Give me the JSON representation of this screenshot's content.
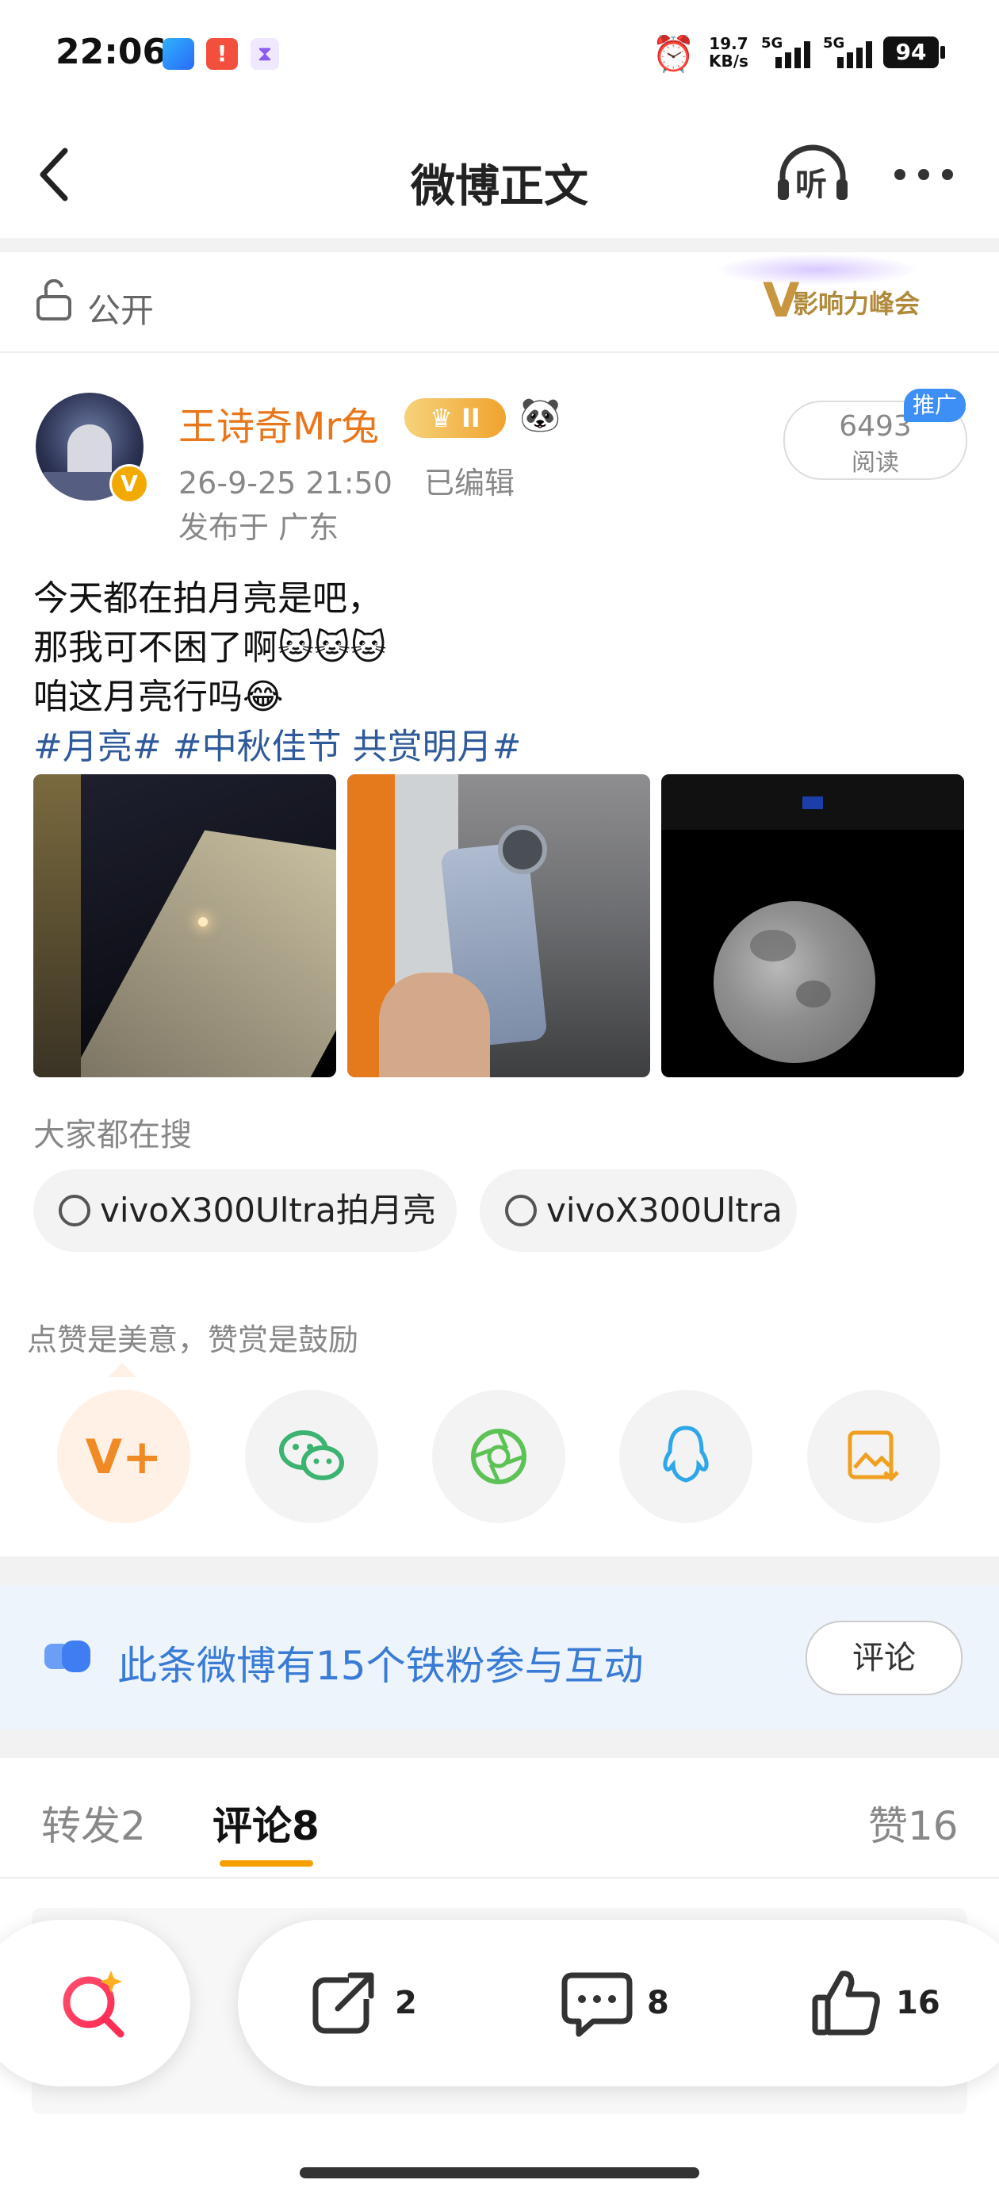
{
  "status_bar": {
    "time": "22:06",
    "net_speed": "19.7",
    "net_unit": "KB/s",
    "sim1": "5G",
    "sim2": "5G",
    "battery": "94"
  },
  "nav": {
    "title": "微博正文",
    "listen_label": "听"
  },
  "post": {
    "visibility": "公开",
    "event_badge": "影响力峰会",
    "author": "王诗奇Mr兔",
    "member_level": "II",
    "time": "26-9-25 21:50",
    "edited": "已编辑",
    "location": "发布于 广东",
    "reads_count": "6493",
    "reads_label": "阅读",
    "promo_label": "推广",
    "lines": [
      "今天都在拍月亮是吧，",
      "那我可不困了啊🐱🐱🐱",
      "咱这月亮行吗😂"
    ],
    "hashtags": "#月亮# #中秋佳节 共赏明月#"
  },
  "searches": {
    "title": "大家都在搜",
    "items": [
      "vivoX300Ultra拍月亮",
      "vivoX300Ultra"
    ]
  },
  "praise": {
    "text": "点赞是美意，赞赏是鼓励",
    "share_buttons": [
      "vplus-icon",
      "wechat-icon",
      "moments-icon",
      "qq-icon",
      "save-image-icon"
    ]
  },
  "fans": {
    "text": "此条微博有15个铁粉参与互动",
    "button": "评论"
  },
  "tabs": {
    "repost": "转发",
    "repost_count": "2",
    "comment": "评论",
    "comment_count": "8",
    "like": "赞",
    "like_count": "16"
  },
  "bottom_bar": {
    "repost_count": "2",
    "comment_count": "8",
    "like_count": "16"
  },
  "colors": {
    "accent_orange": "#e8771c",
    "link_blue": "#2f5a9a",
    "tab_underline": "#f5a000"
  }
}
